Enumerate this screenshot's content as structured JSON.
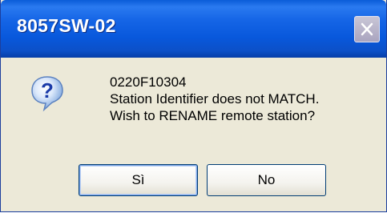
{
  "window": {
    "title": "8057SW-02"
  },
  "dialog": {
    "icon": "question-icon",
    "message_lines": [
      "0220F10304",
      "Station Identifier does not MATCH.",
      "Wish to RENAME remote station?"
    ]
  },
  "buttons": {
    "yes_label": "Sì",
    "no_label": "No"
  },
  "colors": {
    "titlebar": "#0858dc",
    "dialog_background": "#ece9d8",
    "button_border": "#003c74"
  }
}
